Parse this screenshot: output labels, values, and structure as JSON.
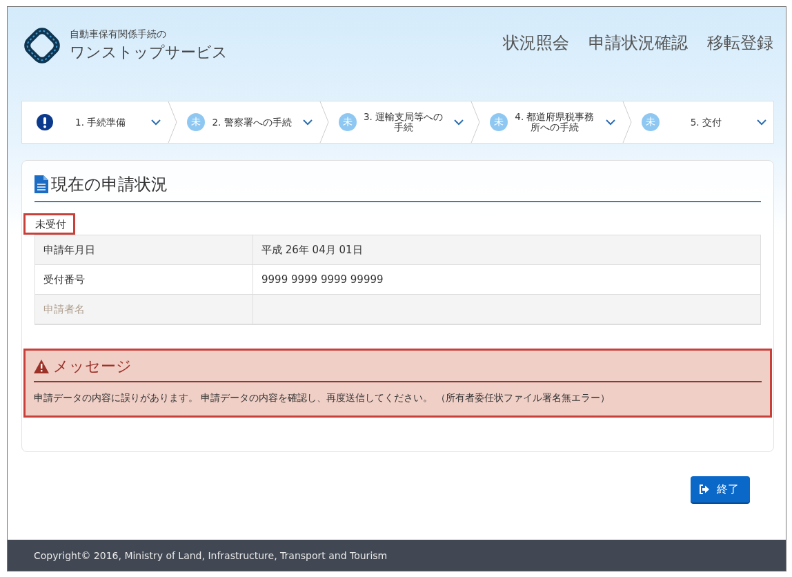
{
  "header": {
    "logo_caption": "自動車保有関係手続の",
    "logo_title": "ワンストップサービス",
    "nav": [
      "状況照会",
      "申請状況確認",
      "移転登録"
    ]
  },
  "steps": [
    {
      "kind": "warning",
      "label_lines": [
        "1. 手続準備"
      ]
    },
    {
      "kind": "pending",
      "badge": "未",
      "label_lines": [
        "2. 警察署への手続"
      ]
    },
    {
      "kind": "pending",
      "badge": "未",
      "label_lines": [
        "3. 運輸支局等への",
        "手続"
      ]
    },
    {
      "kind": "pending",
      "badge": "未",
      "label_lines": [
        "4. 都道府県税事務",
        "所への手続"
      ]
    },
    {
      "kind": "pending",
      "badge": "未",
      "label_lines": [
        "5. 交付"
      ]
    }
  ],
  "status_panel": {
    "title": "現在の申請状況",
    "status": "未受付",
    "rows": [
      {
        "label": "申請年月日",
        "value": "平成 26年 04月 01日",
        "disabled": false
      },
      {
        "label": "受付番号",
        "value": "9999 9999 9999 99999",
        "disabled": false
      },
      {
        "label": "申請者名",
        "value": "",
        "disabled": true
      }
    ]
  },
  "message": {
    "title": "メッセージ",
    "text": "申請データの内容に誤りがあります。 申請データの内容を確認し、再度送信してください。 （所有者委任状ファイル署名無エラー）"
  },
  "exit_button": "終了",
  "footer": "Copyright© 2016, Ministry of Land, Infrastructure, Transport and Tourism"
}
